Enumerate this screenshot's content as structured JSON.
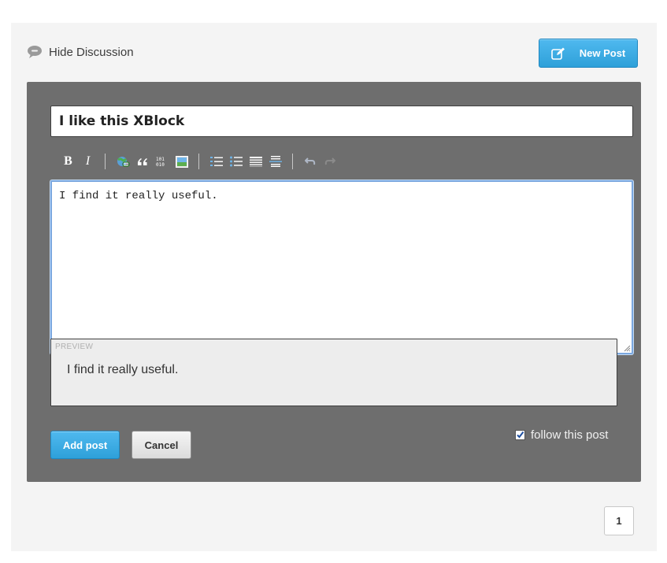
{
  "header": {
    "hide_discussion_label": "Hide Discussion",
    "new_post_label": "New Post"
  },
  "form": {
    "title_value": "I like this XBlock",
    "body_value": "I find it really useful.",
    "preview_label": "PREVIEW",
    "preview_text": "I find it really useful.",
    "add_post_label": "Add post",
    "cancel_label": "Cancel",
    "follow_label": "follow this post",
    "follow_checked": true
  },
  "toolbar": {
    "bold_label": "B",
    "italic_label": "I",
    "icons": [
      "bold-icon",
      "italic-icon",
      "link-icon",
      "blockquote-icon",
      "code-icon",
      "image-icon",
      "numbered-list-icon",
      "bulleted-list-icon",
      "heading-icon",
      "horizontal-rule-icon",
      "undo-icon",
      "redo-icon"
    ]
  },
  "pagination": {
    "current_page": "1"
  },
  "colors": {
    "accent": "#2ea0d9",
    "panel": "#6e6e6e",
    "background": "#f4f4f4"
  }
}
